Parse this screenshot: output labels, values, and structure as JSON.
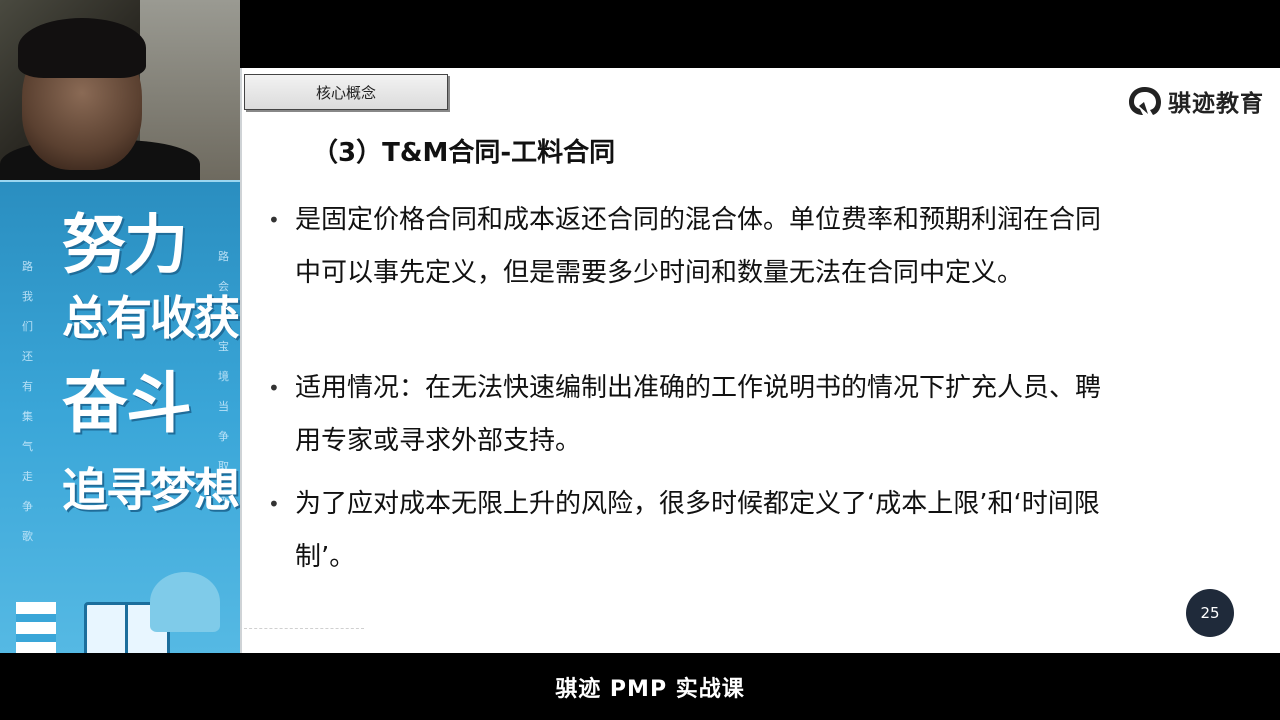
{
  "poster": {
    "line1": "努力",
    "line2": "总有收获",
    "line3": "奋斗",
    "line4": "追寻梦想"
  },
  "slide": {
    "tab_label": "核心概念",
    "logo_text": "骐迹教育",
    "heading": "（3）T&M合同-工料合同",
    "bullets": [
      "是固定价格合同和成本返还合同的混合体。单位费率和预期利润在合同中可以事先定义，但是需要多少时间和数量无法在合同中定义。",
      "适用情况：在无法快速编制出准确的工作说明书的情况下扩充人员、聘用专家或寻求外部支持。",
      "为了应对成本无限上升的风险，很多时候都定义了‘成本上限’和‘时间限制’。"
    ],
    "bullet_marker": "•",
    "page_number": "25"
  },
  "caption": "骐迹 PMP 实战课",
  "colors": {
    "poster_blue": "#3aa6d8",
    "page_badge": "#1f2a3a",
    "slide_bg": "#ffffff"
  }
}
